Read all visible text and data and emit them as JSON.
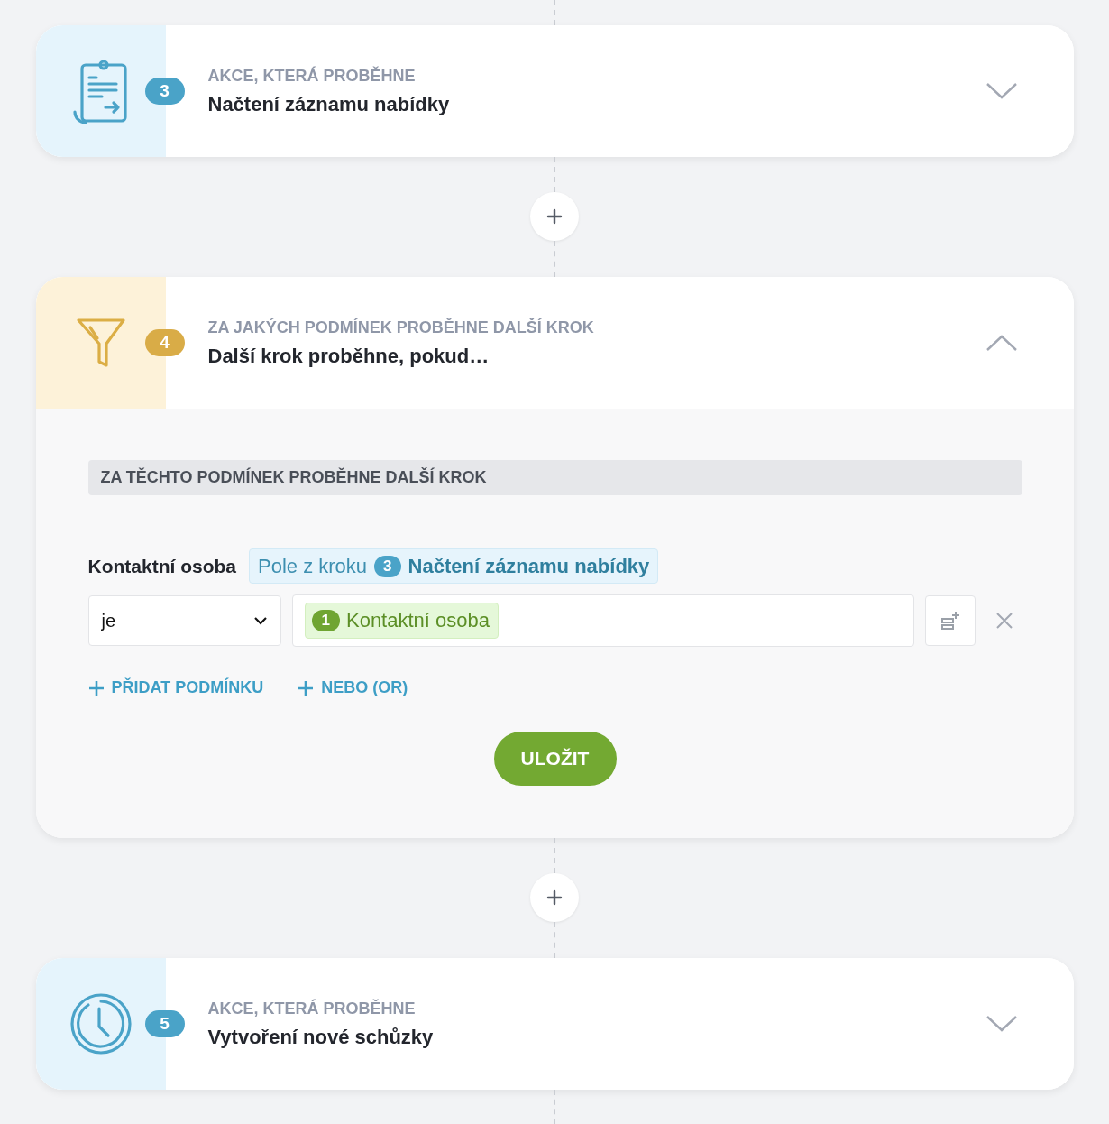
{
  "steps": [
    {
      "kind": "action",
      "number": "3",
      "label": "AKCE, KTERÁ PROBĚHNE",
      "title": "Načtení záznamu nabídky",
      "expanded": false
    },
    {
      "kind": "condition",
      "number": "4",
      "label": "ZA JAKÝCH PODMÍNEK PROBĚHNE DALŠÍ KROK",
      "title": "Další krok proběhne, pokud…",
      "expanded": true,
      "body": {
        "section_title": "ZA TĚCHTO PODMÍNEK PROBĚHNE DALŠÍ KROK",
        "condition": {
          "field_label": "Kontaktní osoba",
          "source_prefix": "Pole z kroku",
          "source_number": "3",
          "source_name": "Načtení záznamu nabídky",
          "operator": "je",
          "value_number": "1",
          "value_label": "Kontaktní osoba"
        },
        "links": [
          "PŘIDAT PODMÍNKU",
          "NEBO (OR)"
        ],
        "save": "ULOŽIT"
      }
    },
    {
      "kind": "action",
      "number": "5",
      "label": "AKCE, KTERÁ PROBĚHNE",
      "title": "Vytvoření nové schůzky",
      "expanded": false
    }
  ]
}
